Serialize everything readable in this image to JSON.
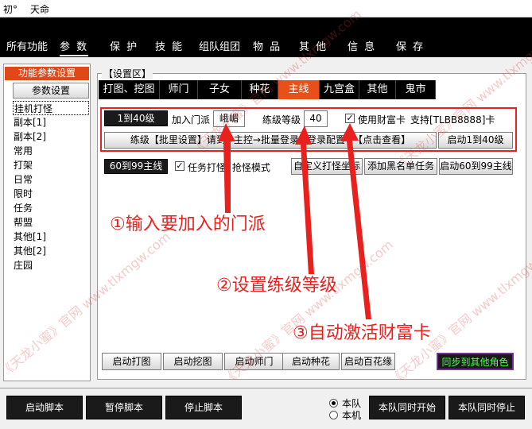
{
  "titlebar": {
    "left_text": "初°",
    "title": "天命"
  },
  "topnav": {
    "tabs": [
      {
        "label": "所有功能"
      },
      {
        "label": "参 数"
      },
      {
        "label": "保 护"
      },
      {
        "label": "技 能"
      },
      {
        "label": "组队组团"
      },
      {
        "label": "物 品"
      },
      {
        "label": "其 他"
      },
      {
        "label": "信 息"
      },
      {
        "label": "保 存"
      }
    ]
  },
  "left_panel": {
    "header": "功能参数设置",
    "button": "参数设置",
    "items": [
      "挂机打怪",
      "副本[1]",
      "副本[2]",
      "常用",
      "打架",
      "日常",
      "限时",
      "任务",
      "帮盟",
      "其他[1]",
      "其他[2]",
      "庄园"
    ]
  },
  "settings": {
    "label": "【设置区】",
    "subtabs": [
      "打图、挖图",
      "师门",
      "子女",
      "种花",
      "主线",
      "九宫盒",
      "其他",
      "鬼市"
    ],
    "row1": {
      "level_badge": "1到40级",
      "join_label": "加入门派",
      "join_value": "峨嵋",
      "lv_label": "练级等级",
      "lv_value": "40",
      "check_label": "使用财富卡",
      "support": "支持[TLBB8888]卡"
    },
    "row2": {
      "info": "练级【批里设置】请到→主控→批量登录→登录配置→【点击查看】",
      "start_button": "启动1到40级"
    },
    "row3": {
      "badge": "60到99主线",
      "check_label": "任务打怪: 抢怪模式",
      "btn1": "自定义打怪坐标",
      "btn2": "添加黑名单任务",
      "btn3": "启动60到99主线"
    },
    "bottom_buttons": [
      "启动打图",
      "启动挖图",
      "启动师门",
      "启动种花",
      "启动百花缘"
    ],
    "sync_button": "同步到其他角色"
  },
  "annotations": [
    "①输入要加入的门派",
    "②设置练级等级",
    "③自动激活财富卡"
  ],
  "watermark": "《天龙小蜜》官网 www.tlxmgw.com",
  "footer": {
    "buttons": [
      "启动脚本",
      "暂停脚本",
      "停止脚本"
    ],
    "radio": [
      "本队",
      "本机"
    ],
    "right_buttons": [
      "本队同时开始",
      "本队同时停止"
    ]
  },
  "colors": {
    "accent": "#e8501a",
    "annotation": "#e8211f",
    "sync_text": "#4cff4c"
  }
}
